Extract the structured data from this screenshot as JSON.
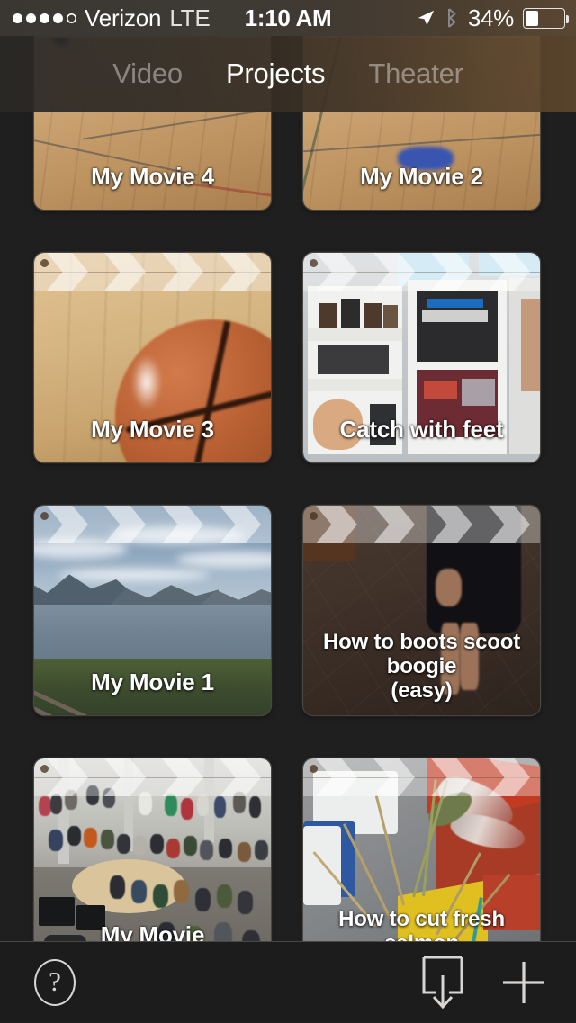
{
  "status_bar": {
    "signal_dots_filled": 4,
    "signal_dots_total": 5,
    "carrier": "Verizon",
    "radio": "LTE",
    "time": "1:10 AM",
    "location_icon": "location-arrow-icon",
    "bluetooth_icon": "bluetooth-icon",
    "battery_percent": "34%",
    "battery_level": 34
  },
  "navbar": {
    "tabs": [
      {
        "label": "Video",
        "active": false
      },
      {
        "label": "Projects",
        "active": true
      },
      {
        "label": "Theater",
        "active": false
      }
    ]
  },
  "projects": [
    {
      "title": "My Movie 4",
      "lines": 1,
      "art": "gym",
      "clipped_top": true
    },
    {
      "title": "My Movie 2",
      "lines": 1,
      "art": "gym2",
      "clipped_top": true
    },
    {
      "title": "My Movie 3",
      "lines": 1,
      "art": "bball",
      "clipped_top": false
    },
    {
      "title": "Catch with feet",
      "lines": 1,
      "art": "room",
      "clipped_top": false
    },
    {
      "title": "My Movie 1",
      "lines": 1,
      "art": "lake",
      "clipped_top": false
    },
    {
      "title": "How to boots scoot boogie (easy)",
      "title_line1": "How to boots scoot boogie",
      "title_line2": "(easy)",
      "lines": 2,
      "art": "dark",
      "clipped_top": false
    },
    {
      "title": "My Movie",
      "lines": 1,
      "art": "crowd",
      "clipped_top": false
    },
    {
      "title": "How to cut fresh salmon",
      "title_line1": "How to cut fresh",
      "title_line2": "salmon",
      "lines": 2,
      "art": "fish",
      "clipped_top": false
    }
  ],
  "toolbar": {
    "help_label": "?",
    "help_icon": "question-mark-circle-icon",
    "import_icon": "import-download-icon",
    "add_icon": "plus-icon"
  },
  "colors": {
    "background": "#201F1F",
    "toolbar_background": "#1D1C1C",
    "toolbar_divider": "#4A4848",
    "tab_active": "#FFFFFF",
    "tab_inactive": "rgba(255,255,255,0.40)",
    "icon_stroke": "#D8D6D4",
    "navbar_tint_left": "#2A2825",
    "navbar_tint_right": "#5C462D"
  }
}
